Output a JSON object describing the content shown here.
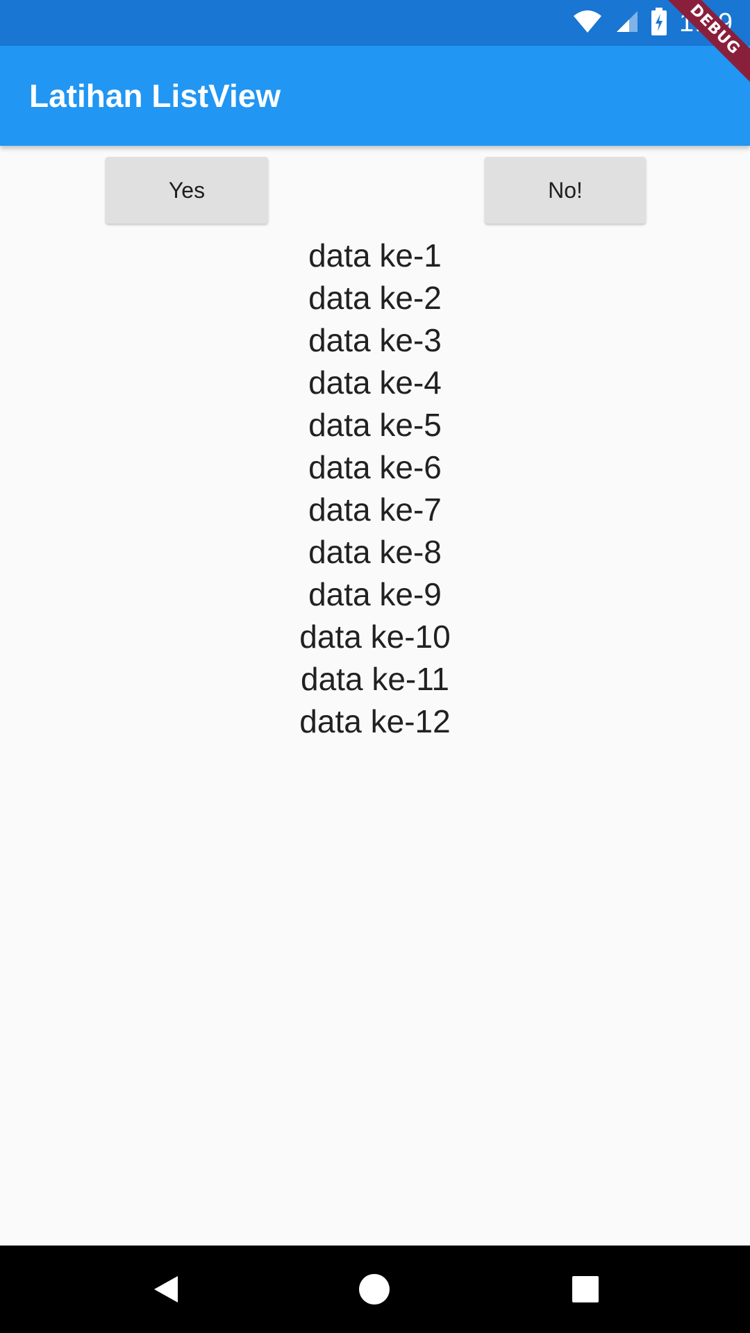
{
  "status_bar": {
    "time": "1:49",
    "icons": [
      "wifi-icon",
      "cell-signal-icon",
      "battery-charging-icon"
    ]
  },
  "debug_banner": {
    "label": "DEBUG"
  },
  "app_bar": {
    "title": "Latihan ListView"
  },
  "buttons": {
    "yes_label": "Yes",
    "no_label": "No!"
  },
  "list": {
    "items": [
      "data ke-1",
      "data ke-2",
      "data ke-3",
      "data ke-4",
      "data ke-5",
      "data ke-6",
      "data ke-7",
      "data ke-8",
      "data ke-9",
      "data ke-10",
      "data ke-11",
      "data ke-12"
    ]
  },
  "nav_bar": {
    "icons": [
      "back-icon",
      "home-icon",
      "recents-icon"
    ]
  },
  "colors": {
    "status_bar": "#1976d2",
    "app_bar": "#2196f3",
    "background": "#fafafa",
    "button": "#e0e0e0",
    "debug_banner": "#8a1f3c"
  }
}
